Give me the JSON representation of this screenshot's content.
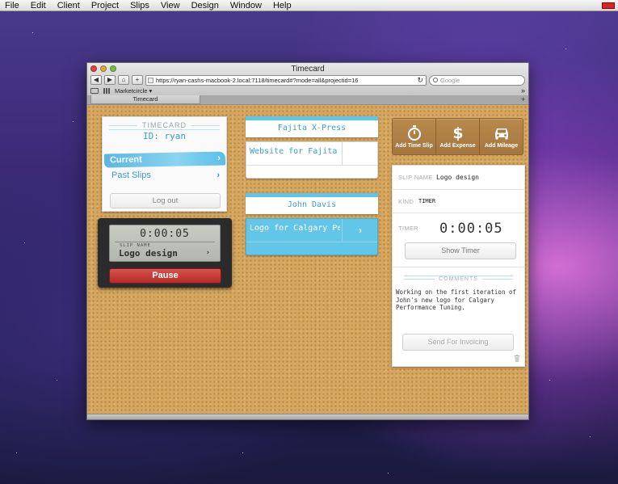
{
  "menubar": {
    "items": [
      "File",
      "Edit",
      "Client",
      "Project",
      "Slips",
      "View",
      "Design",
      "Window",
      "Help"
    ]
  },
  "browser": {
    "window_title": "Timecard",
    "url": "https://ryan-cashs-macbook-2.local:7118/timecard#?mode=all&projectid=16",
    "search_placeholder": "Google",
    "bookmark": "Marketcircle",
    "tab": "Timecard"
  },
  "timecard": {
    "header": "TIMECARD",
    "id_line": "ID: ryan",
    "menu": {
      "current": "Current",
      "past": "Past Slips"
    },
    "logout": "Log out"
  },
  "timer_widget": {
    "time": "0:00:05",
    "slip_name_label": "SLIP NAME",
    "slip_name": "Logo design",
    "pause": "Pause"
  },
  "clients": [
    {
      "name": "Fajita X-Press",
      "slips": [
        "Website for Fajita X-Press"
      ]
    },
    {
      "name": "John Davis",
      "slips": [
        "Logo for Calgary Performance Tuning"
      ]
    }
  ],
  "add_bar": {
    "time_slip": "Add Time Slip",
    "expense": "Add Expense",
    "mileage": "Add Mileage"
  },
  "detail": {
    "slip_name_label": "SLIP NAME",
    "slip_name": "Logo design",
    "kind_label": "KIND",
    "kind": "TIMER",
    "timer_label": "TIMER",
    "timer": "0:00:05",
    "show_timer": "Show Timer",
    "comments_label": "COMMENTS",
    "comments": "Working on the first iteration of John's new logo for Calgary Performance Tuning.",
    "send": "Send For Invoicing"
  },
  "colors": {
    "accent_blue": "#5ec6e8",
    "pause_red": "#c0352f",
    "cork": "#d4a65e"
  }
}
